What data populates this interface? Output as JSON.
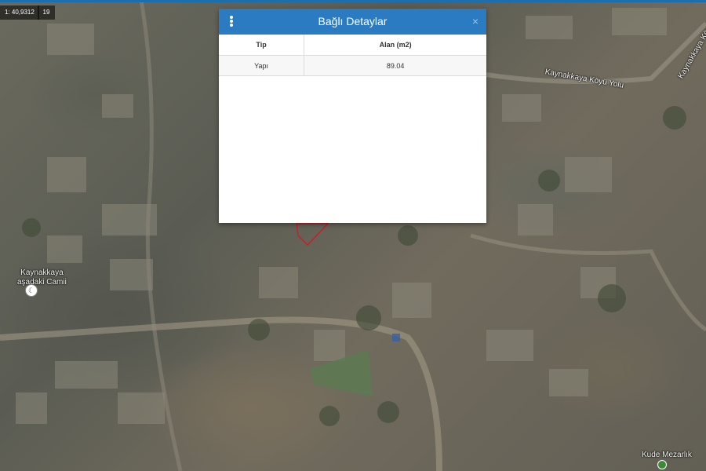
{
  "map": {
    "coordinate_readout": "1: 40,9312",
    "zoom_level": "19",
    "labels": {
      "road_1": "Kaynakkaya Köyü Yolu",
      "road_2": "Kaynakkaya Köyü Yolu",
      "mosque_line1": "Kaynakkaya",
      "mosque_line2": "aşadaki Camii",
      "cemetery": "Kude Mezarlık"
    },
    "accent_color": "#2a7bc1"
  },
  "dialog": {
    "title": "Bağlı Detaylar",
    "close_symbol": "×",
    "menu_icon": "kebab-menu-icon",
    "columns": [
      "Tip",
      "Alan (m2)"
    ],
    "rows": [
      [
        "Yapı",
        "89.04"
      ]
    ]
  }
}
